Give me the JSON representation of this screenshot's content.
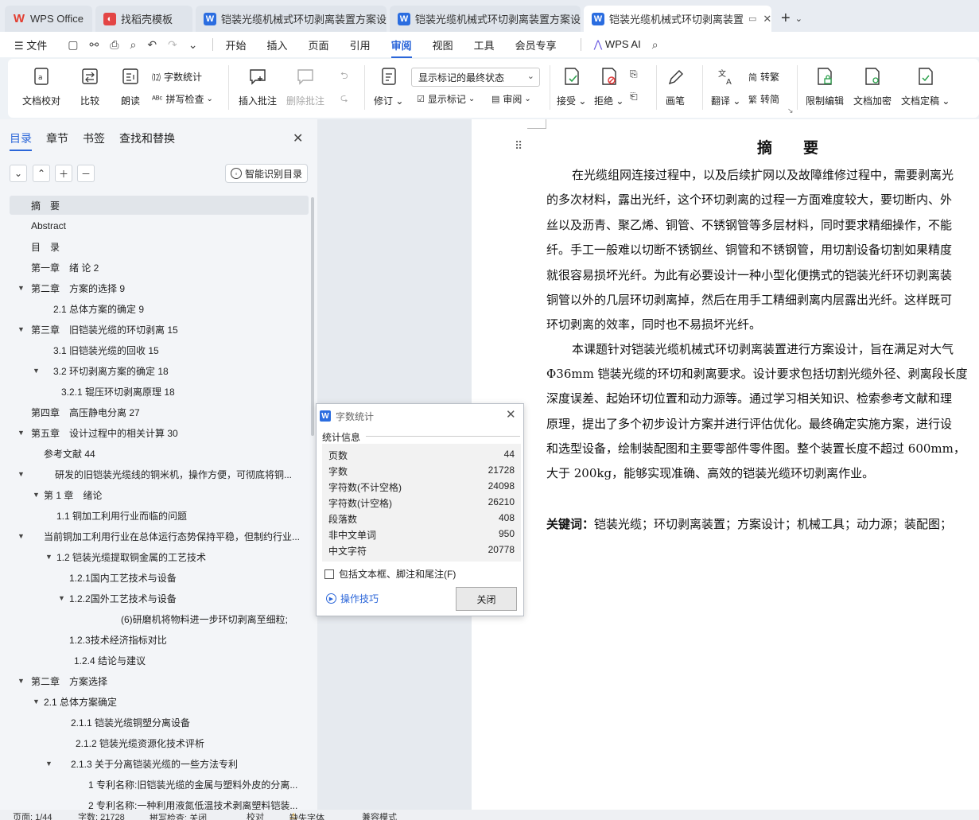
{
  "tabs": [
    {
      "label": "WPS Office",
      "icon": "wps-logo-icon"
    },
    {
      "label": "找稻壳模板",
      "icon": "docer-icon"
    },
    {
      "label": "铠装光缆机械式环切剥离装置方案设计",
      "icon": "writer-doc-icon"
    },
    {
      "label": "铠装光缆机械式环切剥离装置方案设计",
      "icon": "writer-doc-icon"
    },
    {
      "label": "铠装光缆机械式环切剥离装置",
      "icon": "writer-doc-icon"
    }
  ],
  "menu": {
    "file": "文件",
    "items": [
      "开始",
      "插入",
      "页面",
      "引用",
      "审阅",
      "视图",
      "工具",
      "会员专享"
    ],
    "active": "审阅",
    "ai": "WPS AI"
  },
  "ribbon": {
    "doc_check": "文档校对",
    "compare": "比较",
    "read_aloud": "朗读",
    "word_count": "字数统计",
    "spell_check": "拼写检查",
    "insert_comment": "插入批注",
    "delete_comment": "删除批注",
    "track_changes": "修订",
    "markup_select": "显示标记的最终状态",
    "show_markup": "显示标记",
    "review_pane": "审阅",
    "accept": "接受",
    "reject": "拒绝",
    "pen": "画笔",
    "translate": "翻译",
    "to_traditional": "转繁",
    "to_simplified": "转简",
    "restrict_edit": "限制编辑",
    "encrypt": "文档加密",
    "finalize": "文档定稿"
  },
  "panel": {
    "tabs": [
      "目录",
      "章节",
      "书签",
      "查找和替换"
    ],
    "active_tab": "目录",
    "smart_button": "智能识别目录",
    "toc": [
      {
        "text": "摘　要",
        "selected": true
      },
      {
        "text": "Abstract"
      },
      {
        "text": "目　录"
      },
      {
        "text": "第一章　绪 论 2"
      },
      {
        "text": "第二章　方案的选择 9"
      },
      {
        "text": "2.1 总体方案的确定 9"
      },
      {
        "text": "第三章　旧铠装光缆的环切剥离 15"
      },
      {
        "text": "3.1 旧铠装光缆的回收 15"
      },
      {
        "text": "3.2 环切剥离方案的确定 18"
      },
      {
        "text": "3.2.1 辊压环切剥离原理 18"
      },
      {
        "text": "第四章　高压静电分离 27"
      },
      {
        "text": "第五章　设计过程中的相关计算 30"
      },
      {
        "text": "参考文献 44"
      },
      {
        "text": "研发的旧铠装光缆线的铜米机，操作方便，可彻底将铜..."
      },
      {
        "text": "第 1 章　绪论"
      },
      {
        "text": "1.1  铜加工利用行业而临的问题"
      },
      {
        "text": "当前铜加工利用行业在总体运行态势保持平稳，但制约行业..."
      },
      {
        "text": "1.2  铠装光缆提取铜金属的工艺技术"
      },
      {
        "text": "1.2.1国内工艺技术与设备"
      },
      {
        "text": "1.2.2国外工艺技术与设备"
      },
      {
        "text": "(6)研磨机将物料进一步环切剥离至细粒;"
      },
      {
        "text": "1.2.3技术经济指标对比"
      },
      {
        "text": "1.2.4  结论与建议"
      },
      {
        "text": "第二章　方案选择"
      },
      {
        "text": "2.1  总体方案确定"
      },
      {
        "text": "2.1.1 铠装光缆铜塑分离设备"
      },
      {
        "text": "2.1.2 铠装光缆资源化技术评析"
      },
      {
        "text": "2.1.3 关于分离铠装光缆的一些方法专利"
      },
      {
        "text": "1 专利名称:旧铠装光缆的金属与塑料外皮的分离..."
      },
      {
        "text": "2 专利名称:一种利用液氮低温技术剥离塑料铠装..."
      }
    ]
  },
  "document": {
    "title": "摘　要",
    "lines": [
      "在光缆组网连接过程中，以及后续扩网以及故障维修过程中，需要剥离光",
      "的多次材料，露出光纤，这个环切剥离的过程一方面难度较大，要切断内、外",
      "丝以及沥青、聚乙烯、铜管、不锈钢管等多层材料，同时要求精细操作，不能",
      "纤。手工一般难以切断不锈钢丝、铜管和不锈钢管，用切割设备切割如果精度",
      "就很容易损坏光纤。为此有必要设计一种小型化便携式的铠装光纤环切剥离装",
      "铜管以外的几层环切剥离掉，然后在用手工精细剥离内层露出光纤。这样既可",
      "环切剥离的效率，同时也不易损坏光纤。",
      "本课题针对铠装光缆机械式环切剥离装置进行方案设计，旨在满足对大气",
      "Φ36mm 铠装光缆的环切和剥离要求。设计要求包括切割光缆外径、剥离段长度",
      "深度误差、起始环切位置和动力源等。通过学习相关知识、检索参考文献和理",
      "原理，提出了多个初步设计方案并进行评估优化。最终确定实施方案，进行设",
      "和选型设备，绘制装配图和主要零部件零件图。整个装置长度不超过 600mm，",
      "大于 200kg，能够实现准确、高效的铠装光缆环切剥离作业。"
    ],
    "keywords_label": "关键词：",
    "keywords": "铠装光缆；环切剥离装置；方案设计；机械工具；动力源；装配图；"
  },
  "dialog": {
    "title": "字数统计",
    "section": "统计信息",
    "stats": [
      {
        "label": "页数",
        "value": "44"
      },
      {
        "label": "字数",
        "value": "21728"
      },
      {
        "label": "字符数(不计空格)",
        "value": "24098"
      },
      {
        "label": "字符数(计空格)",
        "value": "26210"
      },
      {
        "label": "段落数",
        "value": "408"
      },
      {
        "label": "非中文单词",
        "value": "950"
      },
      {
        "label": "中文字符",
        "value": "20778"
      }
    ],
    "checkbox": "包括文本框、脚注和尾注(F)",
    "tips": "操作技巧",
    "close_button": "关闭"
  },
  "status": {
    "page": "页面: 1/44",
    "words": "字数: 21728",
    "spell": "拼写检查: 关闭",
    "proof": "校对",
    "missing_font": "缺失字体",
    "compat": "兼容模式"
  }
}
